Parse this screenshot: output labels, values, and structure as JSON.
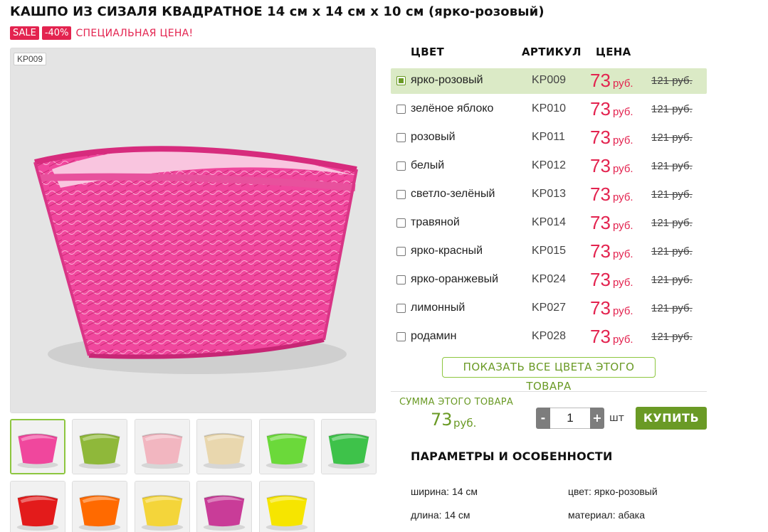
{
  "product": {
    "title": "КАШПО ИЗ СИЗАЛЯ КВАДРАТНОЕ 14 см х 14 см х 10 см (ярко-розовый)",
    "sale_badge": "SALE",
    "discount_badge": "-40%",
    "special_text": "СПЕЦИАЛЬНАЯ ЦЕНА!",
    "photo_sku": "KP009",
    "photo_color": "#f0479d"
  },
  "thumbnails": [
    {
      "color": "#f0479d",
      "active": true
    },
    {
      "color": "#8fb83a",
      "active": false
    },
    {
      "color": "#f2b6c0",
      "active": false
    },
    {
      "color": "#e9d7ae",
      "active": false
    },
    {
      "color": "#6bd93a",
      "active": false
    },
    {
      "color": "#3ec24a",
      "active": false
    },
    {
      "color": "#e31b1b",
      "active": false
    },
    {
      "color": "#ff6a00",
      "active": false
    },
    {
      "color": "#f4d53a",
      "active": false
    },
    {
      "color": "#c93c98",
      "active": false
    },
    {
      "color": "#f6e500",
      "active": false
    }
  ],
  "table": {
    "col_color": "ЦВЕТ",
    "col_sku": "АРТИКУЛ",
    "col_price": "ЦЕНА",
    "rows": [
      {
        "name": "ярко-розовый",
        "sku": "KP009",
        "price": "73",
        "currency": "руб.",
        "old": "121 руб.",
        "selected": true
      },
      {
        "name": "зелёное яблоко",
        "sku": "KP010",
        "price": "73",
        "currency": "руб.",
        "old": "121 руб.",
        "selected": false
      },
      {
        "name": "розовый",
        "sku": "KP011",
        "price": "73",
        "currency": "руб.",
        "old": "121 руб.",
        "selected": false
      },
      {
        "name": "белый",
        "sku": "KP012",
        "price": "73",
        "currency": "руб.",
        "old": "121 руб.",
        "selected": false
      },
      {
        "name": "светло-зелёный",
        "sku": "KP013",
        "price": "73",
        "currency": "руб.",
        "old": "121 руб.",
        "selected": false
      },
      {
        "name": "травяной",
        "sku": "KP014",
        "price": "73",
        "currency": "руб.",
        "old": "121 руб.",
        "selected": false
      },
      {
        "name": "ярко-красный",
        "sku": "KP015",
        "price": "73",
        "currency": "руб.",
        "old": "121 руб.",
        "selected": false
      },
      {
        "name": "ярко-оранжевый",
        "sku": "KP024",
        "price": "73",
        "currency": "руб.",
        "old": "121 руб.",
        "selected": false
      },
      {
        "name": "лимонный",
        "sku": "KP027",
        "price": "73",
        "currency": "руб.",
        "old": "121 руб.",
        "selected": false
      },
      {
        "name": "родамин",
        "sku": "KP028",
        "price": "73",
        "currency": "руб.",
        "old": "121 руб.",
        "selected": false
      }
    ]
  },
  "show_all_label": "ПОКАЗАТЬ ВСЕ ЦВЕТА ЭТОГО ТОВАРА",
  "summary": {
    "label": "СУММА ЭТОГО ТОВАРА",
    "value": "73",
    "currency": "руб."
  },
  "quantity": {
    "minus": "-",
    "value": "1",
    "plus": "+",
    "unit": "шт"
  },
  "buy_label": "КУПИТЬ",
  "params": {
    "heading": "ПАРАМЕТРЫ И ОСОБЕННОСТИ",
    "width": "ширина: 14 см",
    "length": "длина: 14 см",
    "color": "цвет: ярко-розовый",
    "material": "материал: абака"
  },
  "colors": {
    "accent_red": "#e3234f",
    "accent_green": "#6a9a25",
    "selected_row_bg": "#dbeac6"
  }
}
